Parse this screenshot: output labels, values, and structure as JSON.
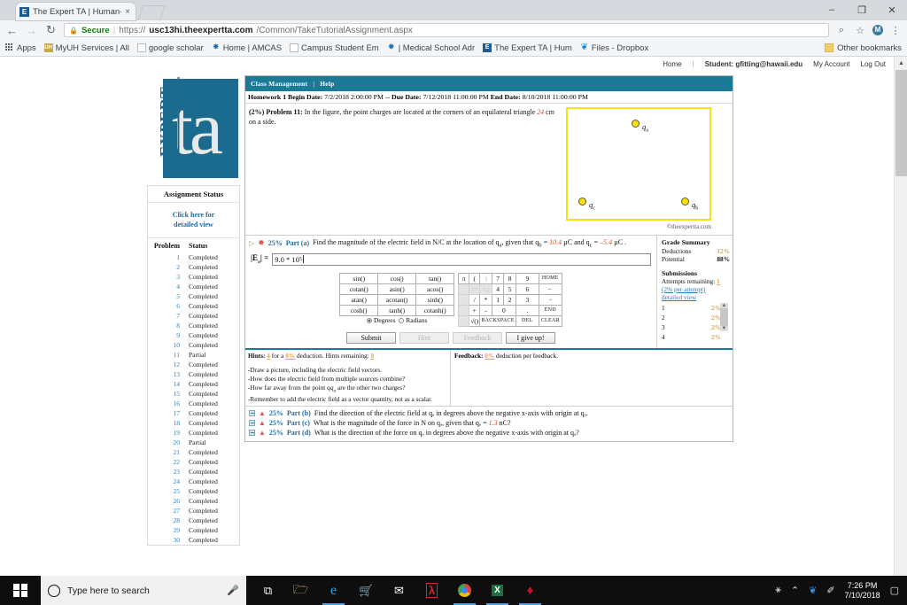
{
  "browser": {
    "tab": {
      "title": "The Expert TA | Human-li",
      "favicon": "expert-ta-icon",
      "close": "×"
    },
    "window_controls": {
      "minimize": "–",
      "maximize": "❐",
      "close": "✕"
    },
    "nav": {
      "back": "←",
      "forward": "→",
      "reload": "↻"
    },
    "omnibox": {
      "lock": "🔒",
      "secure_label": "Secure",
      "url_scheme": "https://",
      "url_host": "usc13hi.theexpertta.com",
      "url_path": "/Common/TakeTutorialAssignment.aspx",
      "zoom_icon": "⌕",
      "star_icon": "☆",
      "extension_icon": "M",
      "menu_icon": "⋮"
    },
    "bookmarks": [
      {
        "label": "Apps",
        "icon": "apps-grid-icon"
      },
      {
        "label": "MyUH Services | All",
        "icon": "uh-icon"
      },
      {
        "label": "google scholar",
        "icon": "document-icon"
      },
      {
        "label": "Home | AMCAS",
        "icon": "firefox-icon"
      },
      {
        "label": "Campus Student Em",
        "icon": "document-icon"
      },
      {
        "label": "| Medical School Adr",
        "icon": "firefox-icon"
      },
      {
        "label": "The Expert TA | Hum",
        "icon": "expert-ta-icon"
      },
      {
        "label": "Files - Dropbox",
        "icon": "dropbox-icon"
      }
    ],
    "other_bookmarks": {
      "label": "Other bookmarks",
      "icon": "folder-icon"
    }
  },
  "topnav": {
    "home": "Home",
    "separator": "|",
    "student": "Student: gfitting@hawaii.edu",
    "my_account": "My Account",
    "log_out": "Log Out"
  },
  "logo": {
    "word_expert": "EXPERT",
    "word_ta": "ta"
  },
  "sidebar": {
    "title": "Assignment Status",
    "detail_link_line1": "Click here for",
    "detail_link_line2": "detailed view",
    "col_problem": "Problem",
    "col_status": "Status",
    "rows": [
      {
        "n": "1",
        "status": "Completed"
      },
      {
        "n": "2",
        "status": "Completed"
      },
      {
        "n": "3",
        "status": "Completed"
      },
      {
        "n": "4",
        "status": "Completed"
      },
      {
        "n": "5",
        "status": "Completed"
      },
      {
        "n": "6",
        "status": "Completed"
      },
      {
        "n": "7",
        "status": "Completed"
      },
      {
        "n": "8",
        "status": "Completed"
      },
      {
        "n": "9",
        "status": "Completed"
      },
      {
        "n": "10",
        "status": "Completed"
      },
      {
        "n": "11",
        "status": "Partial"
      },
      {
        "n": "12",
        "status": "Completed"
      },
      {
        "n": "13",
        "status": "Completed"
      },
      {
        "n": "14",
        "status": "Completed"
      },
      {
        "n": "15",
        "status": "Completed"
      },
      {
        "n": "16",
        "status": "Completed"
      },
      {
        "n": "17",
        "status": "Completed"
      },
      {
        "n": "18",
        "status": "Completed"
      },
      {
        "n": "19",
        "status": "Completed"
      },
      {
        "n": "20",
        "status": "Partial"
      },
      {
        "n": "21",
        "status": "Completed"
      },
      {
        "n": "22",
        "status": "Completed"
      },
      {
        "n": "23",
        "status": "Completed"
      },
      {
        "n": "24",
        "status": "Completed"
      },
      {
        "n": "25",
        "status": "Completed"
      },
      {
        "n": "26",
        "status": "Completed"
      },
      {
        "n": "27",
        "status": "Completed"
      },
      {
        "n": "28",
        "status": "Completed"
      },
      {
        "n": "29",
        "status": "Completed"
      },
      {
        "n": "30",
        "status": "Completed"
      }
    ]
  },
  "panel": {
    "menu": {
      "class_management": "Class Management",
      "separator": "|",
      "help": "Help"
    },
    "homework": {
      "name": "Homework 1",
      "begin_label": "Begin Date:",
      "begin_value": "7/2/2018 2:00:00 PM --",
      "due_label": "Due Date:",
      "due_value": "7/12/2018 11:00:00 PM",
      "end_label": "End Date:",
      "end_value": "8/10/2018 11:00:00 PM"
    },
    "problem": {
      "weight": "(2%)",
      "title": "Problem 11:",
      "text_1": "In the figure, the point charges are located at the corners of an equilateral triangle",
      "side_value": "24",
      "text_2": "cm on a side."
    },
    "figure": {
      "charge_a": "q",
      "charge_a_sub": "a",
      "charge_b": "q",
      "charge_b_sub": "b",
      "charge_c": "q",
      "charge_c_sub": "c",
      "credit": "©theexpertta.com"
    },
    "part_a": {
      "expand_icon": "▷",
      "star_icon": "✸",
      "percent": "25%",
      "label": "Part (a)",
      "question_1": "Find the magnitude of the electric field in N/C at the location of q",
      "question_sub_1": "a",
      "question_2": ", given that q",
      "question_sub_2": "b",
      "question_3": " = ",
      "value_b": "10.4",
      "question_4": " µC and q",
      "question_sub_3": "c",
      "question_5": " = ",
      "value_c": "–5.4",
      "question_6": " µC .",
      "answer_label": "|E",
      "answer_label_sub": "a",
      "answer_label_end": "| =",
      "answer_value": "9.0 * 10",
      "answer_exp": "5"
    },
    "keypad": {
      "functions": [
        [
          "sin()",
          "cos()",
          "tan()"
        ],
        [
          "cotan()",
          "asin()",
          "acos()"
        ],
        [
          "atan()",
          "acotan()",
          "sinh()"
        ],
        [
          "cosh()",
          "tanh()",
          "cotanh()"
        ]
      ],
      "degrees": "Degrees",
      "radians": "Radians",
      "mode_selected": "Degrees",
      "numpad": [
        [
          "π",
          "(",
          ")",
          "7",
          "8",
          "9",
          "HOME"
        ],
        [
          "↑^",
          "^↓",
          "4",
          "5",
          "6",
          "←"
        ],
        [
          "/",
          "*",
          "1",
          "2",
          "3",
          "→"
        ],
        [
          "+",
          "-",
          "0",
          ".",
          "END"
        ],
        [
          "√()",
          "BACKSPACE",
          "DEL",
          "CLEAR"
        ]
      ]
    },
    "buttons": {
      "submit": "Submit",
      "hint": "Hint",
      "feedback": "Feedback",
      "give_up": "I give up!"
    },
    "grade_summary": {
      "title": "Grade Summary",
      "deductions_label": "Deductions",
      "deductions_value": "12%",
      "potential_label": "Potential",
      "potential_value": "88%",
      "submissions_title": "Submissions",
      "attempts_label": "Attempts remaining:",
      "attempts_value": "1",
      "per_attempt": "(2% per attempt)",
      "detailed_view": "detailed view",
      "attempts": [
        {
          "n": "1",
          "pct": "2%"
        },
        {
          "n": "2",
          "pct": "2%"
        },
        {
          "n": "3",
          "pct": "2%"
        },
        {
          "n": "4",
          "pct": "2%"
        }
      ],
      "scroll_up": "▲",
      "scroll_down": "▼"
    },
    "hints": {
      "label": "Hints:",
      "count": "4",
      "for_a": "for a",
      "deduction_pct": "0%",
      "deduction_word": "deduction. Hints remaining:",
      "remaining": "0",
      "items": [
        "-Draw a picture, including the electric field vectors.",
        "-How does the electric field from multiple sources combine?",
        "-How far away from the point q",
        "-Remember to add the electric field as a vector quantity, not as a scalar."
      ],
      "item3_sub": "a",
      "item3_rest": " are the other two charges?",
      "feedback_label": "Feedback:",
      "feedback_pct": "0%",
      "feedback_text": "deduction per feedback."
    },
    "other_parts": [
      {
        "percent": "25%",
        "label": "Part (b)",
        "text": "Find the direction of the electric field at qₐ in degrees above the negative x-axis with origin at qₐ."
      },
      {
        "percent": "25%",
        "label": "Part (c)",
        "text_pre": "What is the magnitude of the force in N on qₐ, given that qₐ = ",
        "value": "1.3",
        "text_post": " nC?"
      },
      {
        "percent": "25%",
        "label": "Part (d)",
        "text": "What is the direction of the force on qₐ in degrees above the negative x-axis with origin at qₐ?"
      }
    ]
  },
  "taskbar": {
    "search_placeholder": "Type here to search",
    "cortana_icon": "cortana-circle-icon",
    "mic_icon": "microphone-icon",
    "apps": [
      {
        "name": "task-view-icon",
        "glyph": "⧉"
      },
      {
        "name": "file-explorer-icon",
        "glyph": "🗁"
      },
      {
        "name": "edge-browser-icon",
        "glyph": "e"
      },
      {
        "name": "microsoft-store-icon",
        "glyph": "🛍"
      },
      {
        "name": "mail-icon",
        "glyph": "✉"
      },
      {
        "name": "adobe-reader-icon",
        "glyph": "A"
      },
      {
        "name": "chrome-icon",
        "glyph": "●"
      },
      {
        "name": "excel-icon",
        "glyph": "X"
      },
      {
        "name": "mcafee-icon",
        "glyph": "M"
      }
    ],
    "tray": [
      {
        "name": "people-icon",
        "glyph": "⚹"
      },
      {
        "name": "show-hidden-icons-icon",
        "glyph": "⌃"
      },
      {
        "name": "dropbox-tray-icon",
        "glyph": "❦"
      },
      {
        "name": "pen-tray-icon",
        "glyph": "✐"
      }
    ],
    "time": "7:26 PM",
    "date": "7/10/2018",
    "action_center_icon": "▢"
  },
  "colors": {
    "teal_bar": "#1b7a96",
    "link_blue": "#2a7fb8",
    "accent_orange": "#e8a33d",
    "value_red": "#d0502a",
    "figure_yellow": "#f4e317",
    "charge_yellow": "#ffe000"
  }
}
